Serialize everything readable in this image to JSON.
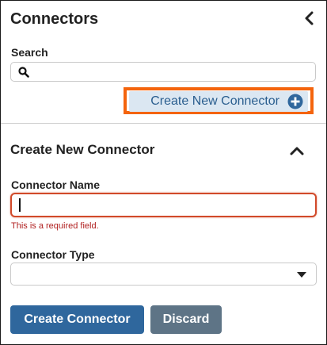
{
  "header": {
    "title": "Connectors",
    "collapse_icon": "chevron-left-icon"
  },
  "search": {
    "label": "Search",
    "value": "",
    "placeholder": "",
    "icon": "search-icon"
  },
  "create_new": {
    "label": "Create New Connector",
    "icon": "plus-circle-icon",
    "highlight_color": "#f4640d"
  },
  "form": {
    "section_title": "Create New Connector",
    "toggle_icon": "chevron-up-icon",
    "connector_name": {
      "label": "Connector Name",
      "value": "",
      "error": "This is a required field."
    },
    "connector_type": {
      "label": "Connector Type",
      "selected": "",
      "dropdown_icon": "caret-down-icon"
    },
    "submit_label": "Create Connector",
    "discard_label": "Discard"
  },
  "colors": {
    "primary": "#2f679d",
    "secondary": "#5e7486",
    "error": "#b01e1e",
    "accent_link": "#2a5e8f"
  }
}
